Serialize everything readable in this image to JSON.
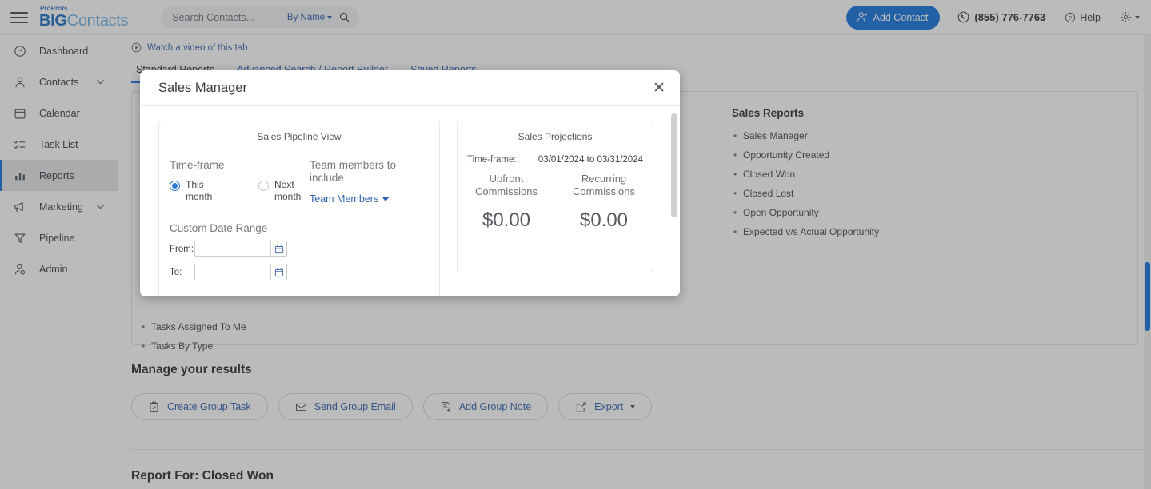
{
  "header": {
    "logo_top": "ProProfs",
    "logo_big": "BIG",
    "logo_rest": "Contacts",
    "search_placeholder": "Search Contacts...",
    "search_value": "",
    "search_filter": "By Name",
    "search_icon": "search-icon",
    "menu_icon": "hamburger-icon",
    "add_contact_label": "Add Contact",
    "phone": "(855) 776-7763",
    "help_label": "Help",
    "settings_icon": "gear-icon"
  },
  "sidebar": {
    "items": [
      {
        "label": "Dashboard",
        "icon": "dashboard-icon",
        "active": false,
        "expandable": false
      },
      {
        "label": "Contacts",
        "icon": "person-icon",
        "active": false,
        "expandable": true
      },
      {
        "label": "Calendar",
        "icon": "calendar-icon",
        "active": false,
        "expandable": false
      },
      {
        "label": "Task List",
        "icon": "tasklist-icon",
        "active": false,
        "expandable": false
      },
      {
        "label": "Reports",
        "icon": "bar-chart-icon",
        "active": true,
        "expandable": false
      },
      {
        "label": "Marketing",
        "icon": "megaphone-icon",
        "active": false,
        "expandable": true
      },
      {
        "label": "Pipeline",
        "icon": "funnel-icon",
        "active": false,
        "expandable": false
      },
      {
        "label": "Admin",
        "icon": "admin-person-icon",
        "active": false,
        "expandable": false
      }
    ]
  },
  "main": {
    "video_link": "Watch a video of this tab",
    "video_icon": "play-circle-icon",
    "tabs": [
      {
        "label": "Standard Reports",
        "active": true
      },
      {
        "label": "Advanced Search / Report Builder",
        "active": false
      },
      {
        "label": "Saved Reports",
        "active": false
      }
    ],
    "sales_reports": {
      "heading": "Sales Reports",
      "items": [
        "Sales Manager",
        "Opportunity Created",
        "Closed Won",
        "Closed Lost",
        "Open Opportunity",
        "Expected v/s Actual Opportunity"
      ]
    },
    "task_reports": {
      "items": [
        "Tasks Assigned To Me",
        "Tasks By Type"
      ]
    },
    "manage": {
      "heading": "Manage your results",
      "buttons": [
        {
          "label": "Create Group Task",
          "icon": "clipboard-check-icon",
          "caret": false
        },
        {
          "label": "Send Group Email",
          "icon": "envelope-icon",
          "caret": false
        },
        {
          "label": "Add Group Note",
          "icon": "note-plus-icon",
          "caret": false
        },
        {
          "label": "Export",
          "icon": "export-icon",
          "caret": true
        }
      ]
    },
    "report_for": "Report For: Closed Won"
  },
  "modal": {
    "title": "Sales Manager",
    "close_icon": "close-icon",
    "pipeline": {
      "card_title": "Sales Pipeline View",
      "timeframe_label": "Time-frame",
      "options": [
        {
          "label": "This month",
          "selected": true
        },
        {
          "label": "Next month",
          "selected": false
        }
      ],
      "team_label": "Team members to include",
      "team_dropdown": "Team Members",
      "custom_range_label": "Custom Date Range",
      "from_label": "From:",
      "from_value": "",
      "to_label": "To:",
      "to_value": "",
      "calendar_icon": "calendar-icon"
    },
    "projections": {
      "card_title": "Sales Projections",
      "timeframe_label": "Time-frame:",
      "timeframe_value": "03/01/2024 to 03/31/2024",
      "columns": [
        {
          "label": "Upfront Commissions",
          "amount": "$0.00"
        },
        {
          "label": "Recurring Commissions",
          "amount": "$0.00"
        }
      ]
    }
  },
  "colors": {
    "accent_blue": "#1675e0",
    "link_blue": "#2f62b0",
    "logo_light": "#6cb3e8",
    "overlay": "rgba(60,60,60,0.35)"
  }
}
